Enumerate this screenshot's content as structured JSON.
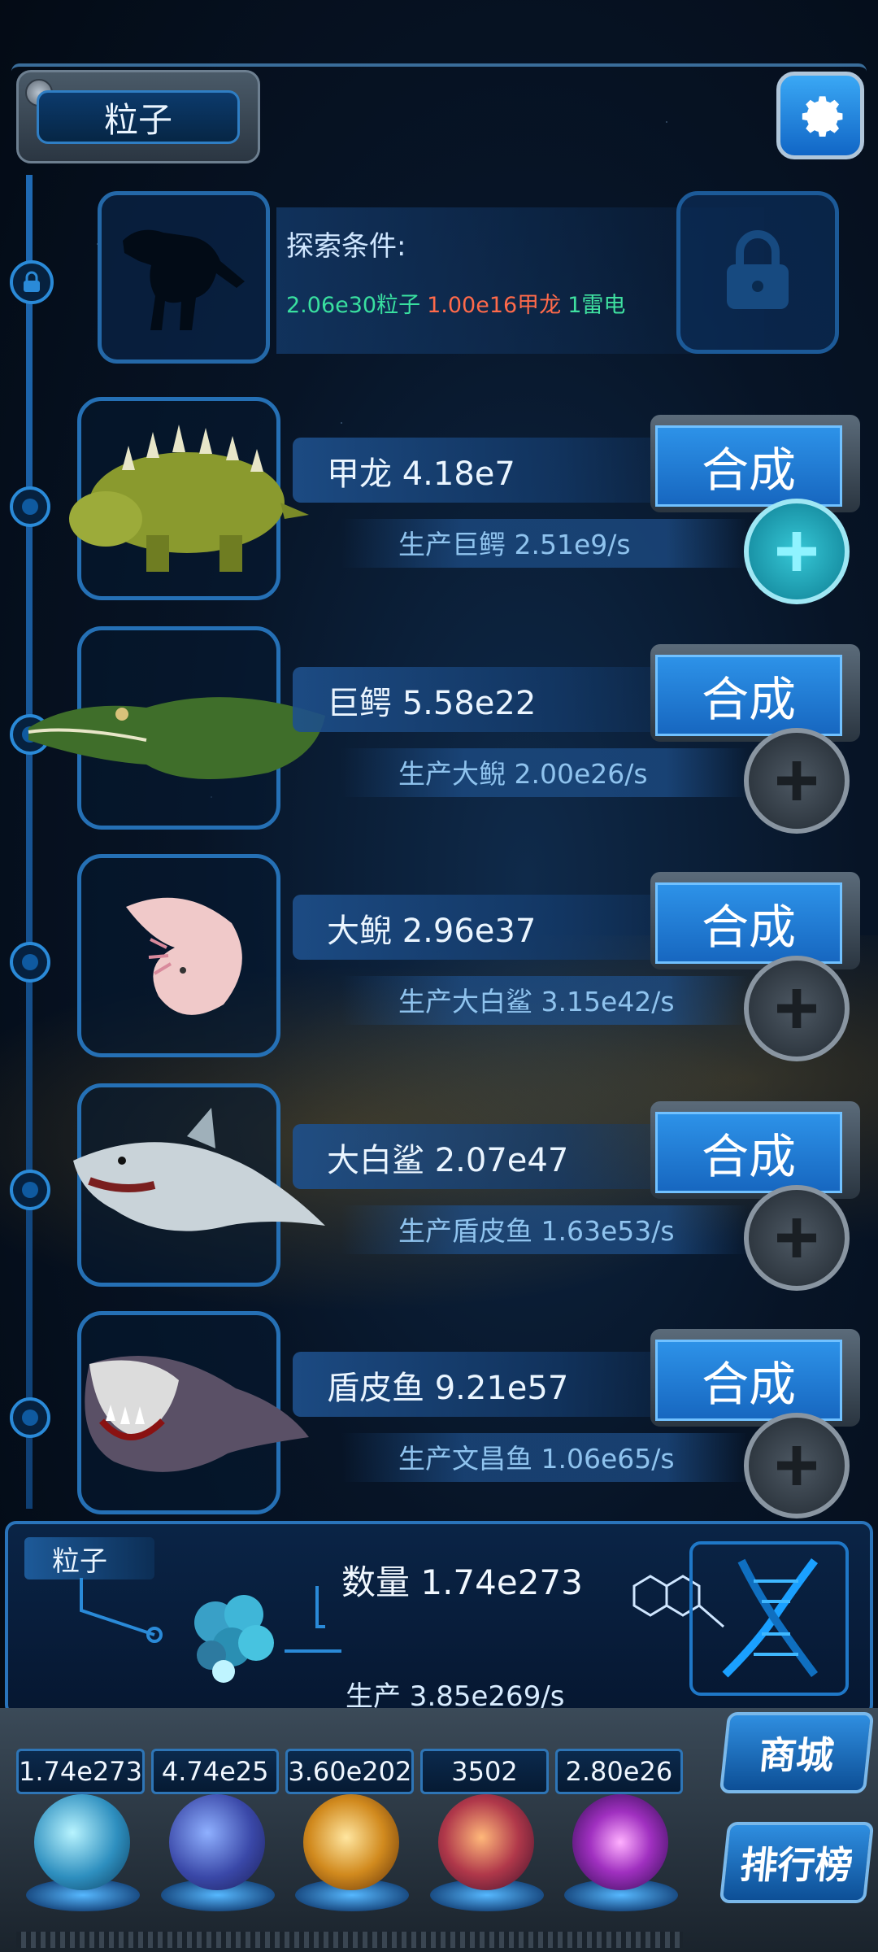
{
  "header": {
    "title": "粒子",
    "settings_icon": "gear-icon"
  },
  "explore": {
    "title": "探索条件:",
    "cond_particles": "2.06e30粒子",
    "cond_ankylosaur": "1.00e16甲龙",
    "cond_thunder": "1雷电"
  },
  "rows": [
    {
      "name": "甲龙 4.18e7",
      "produce": "生产巨鳄 2.51e9/s",
      "merge": "合成",
      "plus_active": true
    },
    {
      "name": "巨鳄 5.58e22",
      "produce": "生产大鲵 2.00e26/s",
      "merge": "合成",
      "plus_active": false
    },
    {
      "name": "大鲵 2.96e37",
      "produce": "生产大白鲨 3.15e42/s",
      "merge": "合成",
      "plus_active": false
    },
    {
      "name": "大白鲨 2.07e47",
      "produce": "生产盾皮鱼 1.63e53/s",
      "merge": "合成",
      "plus_active": false
    },
    {
      "name": "盾皮鱼 9.21e57",
      "produce": "生产文昌鱼 1.06e65/s",
      "merge": "合成",
      "plus_active": false
    }
  ],
  "resource": {
    "tab": "粒子",
    "count": "数量 1.74e273",
    "rate": "生产 3.85e269/s"
  },
  "stats": [
    "1.74e273",
    "4.74e25",
    "3.60e202",
    "3502",
    "2.80e26"
  ],
  "side_buttons": {
    "shop": "商城",
    "rank": "排行榜"
  },
  "colors": {
    "accent": "#2d92e8",
    "cond_particles": "#39e0a0",
    "cond_ankylosaur": "#ff6a4a"
  }
}
